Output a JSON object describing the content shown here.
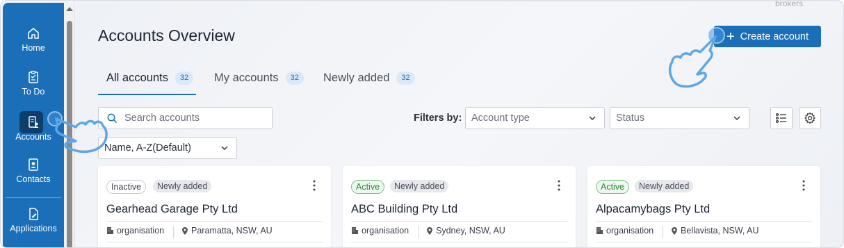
{
  "sidebar": {
    "items": [
      {
        "label": "Home",
        "icon": "home-icon"
      },
      {
        "label": "To Do",
        "icon": "clipboard-icon"
      },
      {
        "label": "Accounts",
        "icon": "accounts-icon"
      },
      {
        "label": "Contacts",
        "icon": "contact-card-icon"
      },
      {
        "label": "Applications",
        "icon": "document-edit-icon"
      }
    ],
    "active": "Accounts",
    "colors": {
      "background": "#1b6fb8",
      "active": "#0f3e6b"
    }
  },
  "header": {
    "brokers_text": "brokers",
    "title": "Accounts Overview",
    "create_label": "Create account"
  },
  "tabs": [
    {
      "label": "All accounts",
      "count": "32"
    },
    {
      "label": "My accounts",
      "count": "32"
    },
    {
      "label": "Newly added",
      "count": "32"
    }
  ],
  "search": {
    "placeholder": "Search accounts"
  },
  "filters": {
    "label": "Filters by:",
    "account_type_placeholder": "Account type",
    "status_placeholder": "Status",
    "sort_value": "Name, A-Z(Default)"
  },
  "cards": [
    {
      "status": "Inactive",
      "tag": "Newly added",
      "name": "Gearhead Garage Pty Ltd",
      "type": "organisation",
      "location": "Paramatta, NSW, AU"
    },
    {
      "status": "Active",
      "tag": "Newly added",
      "name": "ABC Building Pty Ltd",
      "type": "organisation",
      "location": "Sydney, NSW, AU"
    },
    {
      "status": "Active",
      "tag": "Newly added",
      "name": "Alpacamybags Pty Ltd",
      "type": "organisation",
      "location": "Bellavista, NSW, AU"
    }
  ],
  "accent_color": "#1b6fb8"
}
